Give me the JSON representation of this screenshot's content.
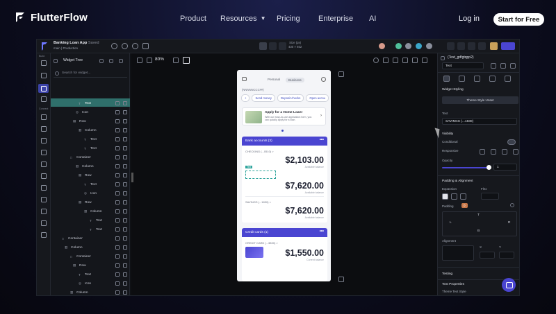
{
  "brand": {
    "name": "FlutterFlow"
  },
  "nav": {
    "items": [
      "Product",
      "Resources",
      "Pricing",
      "Enterprise",
      "AI"
    ],
    "login": "Log in",
    "cta": "Start for Free"
  },
  "editor": {
    "project": {
      "name": "Banking Loan App",
      "saved": "Saved",
      "branch": "main",
      "env": "Production"
    },
    "size_label": {
      "line1": "Size (px)",
      "line2": "430 × 932"
    },
    "rail_labels": [
      "Build",
      "Connect"
    ],
    "zoom": "80%",
    "tree": {
      "title": "Widget Tree",
      "search_placeholder": "Search for widget...",
      "rows": [
        {
          "label": "Text",
          "sym": "T"
        },
        {
          "label": "Icon",
          "sym": "◎"
        },
        {
          "label": "Row",
          "sym": "▤"
        },
        {
          "label": "Column",
          "sym": "▥"
        },
        {
          "label": "Text",
          "sym": "T"
        },
        {
          "label": "Text",
          "sym": "T"
        },
        {
          "label": "Container",
          "sym": "□"
        },
        {
          "label": "Column",
          "sym": "▥"
        },
        {
          "label": "Row",
          "sym": "▤"
        },
        {
          "label": "Text",
          "sym": "T"
        },
        {
          "label": "Icon",
          "sym": "◎"
        },
        {
          "label": "Row",
          "sym": "▤"
        },
        {
          "label": "Column",
          "sym": "▥"
        },
        {
          "label": "Text",
          "sym": "T"
        },
        {
          "label": "Text",
          "sym": "T"
        },
        {
          "label": "Container",
          "sym": "□"
        },
        {
          "label": "Column",
          "sym": "▥"
        },
        {
          "label": "Container",
          "sym": "□"
        },
        {
          "label": "Row",
          "sym": "▤"
        },
        {
          "label": "Text",
          "sym": "T"
        },
        {
          "label": "Icon",
          "sym": "◎"
        },
        {
          "label": "Column",
          "sym": "▥"
        },
        {
          "label": "Column",
          "sym": "▥"
        },
        {
          "label": "Text",
          "sym": "T"
        }
      ]
    },
    "phone": {
      "tabs": [
        "Personal",
        "Business"
      ],
      "account_id": "(NNNNNCCC##)",
      "chips": [
        "+",
        "Send money",
        "Deposit checks",
        "Open accou"
      ],
      "promo": {
        "title": "Apply for a Home Loan!",
        "subtitle": "With our easy-to-use application form, you can quickly apply for a loan."
      },
      "bank_card": {
        "title": "Bank accounts (3)",
        "accounts": [
          {
            "label": "CHECKING (...0510) >",
            "value": "$2,103.00",
            "sub": "Available balance"
          },
          {
            "label": "",
            "value": "$7,620.00",
            "sub": "Available balance"
          },
          {
            "label": "SAVINGS (...1830) >",
            "value": "$7,620.00",
            "sub": "Available balance"
          }
        ],
        "selected_tag": "Text"
      },
      "credit_card": {
        "title": "Credit cards (1)",
        "label": "CREDIT CARD (...3830) >",
        "value": "$1,550.00",
        "sub": "Current balance"
      }
    },
    "props": {
      "widget_id": "(Text_gdfgtqpp2)",
      "widget_type": "Text",
      "section_styling": "Widget Styling",
      "theme_button": "Theme Style Unset",
      "text_label": "Text",
      "text_value": "SAVINGS (...1830)",
      "visibility_label": "Visibility",
      "conditional_label": "Conditional",
      "responsive_label": "Responsive",
      "opacity_label": "Opacity",
      "opacity_value": "1",
      "opacity_level": 1,
      "padding_section": "Padding & Alignment",
      "expansion_label": "Expansion",
      "flex_label": "Flex",
      "padding_label": "Padding",
      "padding_value": "0",
      "pad_letters": [
        "T",
        "L",
        "R",
        "B"
      ],
      "alignment_label": "Alignment",
      "align_x": "X",
      "align_y": "Y",
      "testing_label": "Testing",
      "text_props_label": "Text Properties",
      "theme_text_label": "Theme Text Style"
    }
  },
  "colors": {
    "accent": "#4a45d1",
    "selection": "#2f6f6b",
    "bg": "#0c0d1f"
  }
}
